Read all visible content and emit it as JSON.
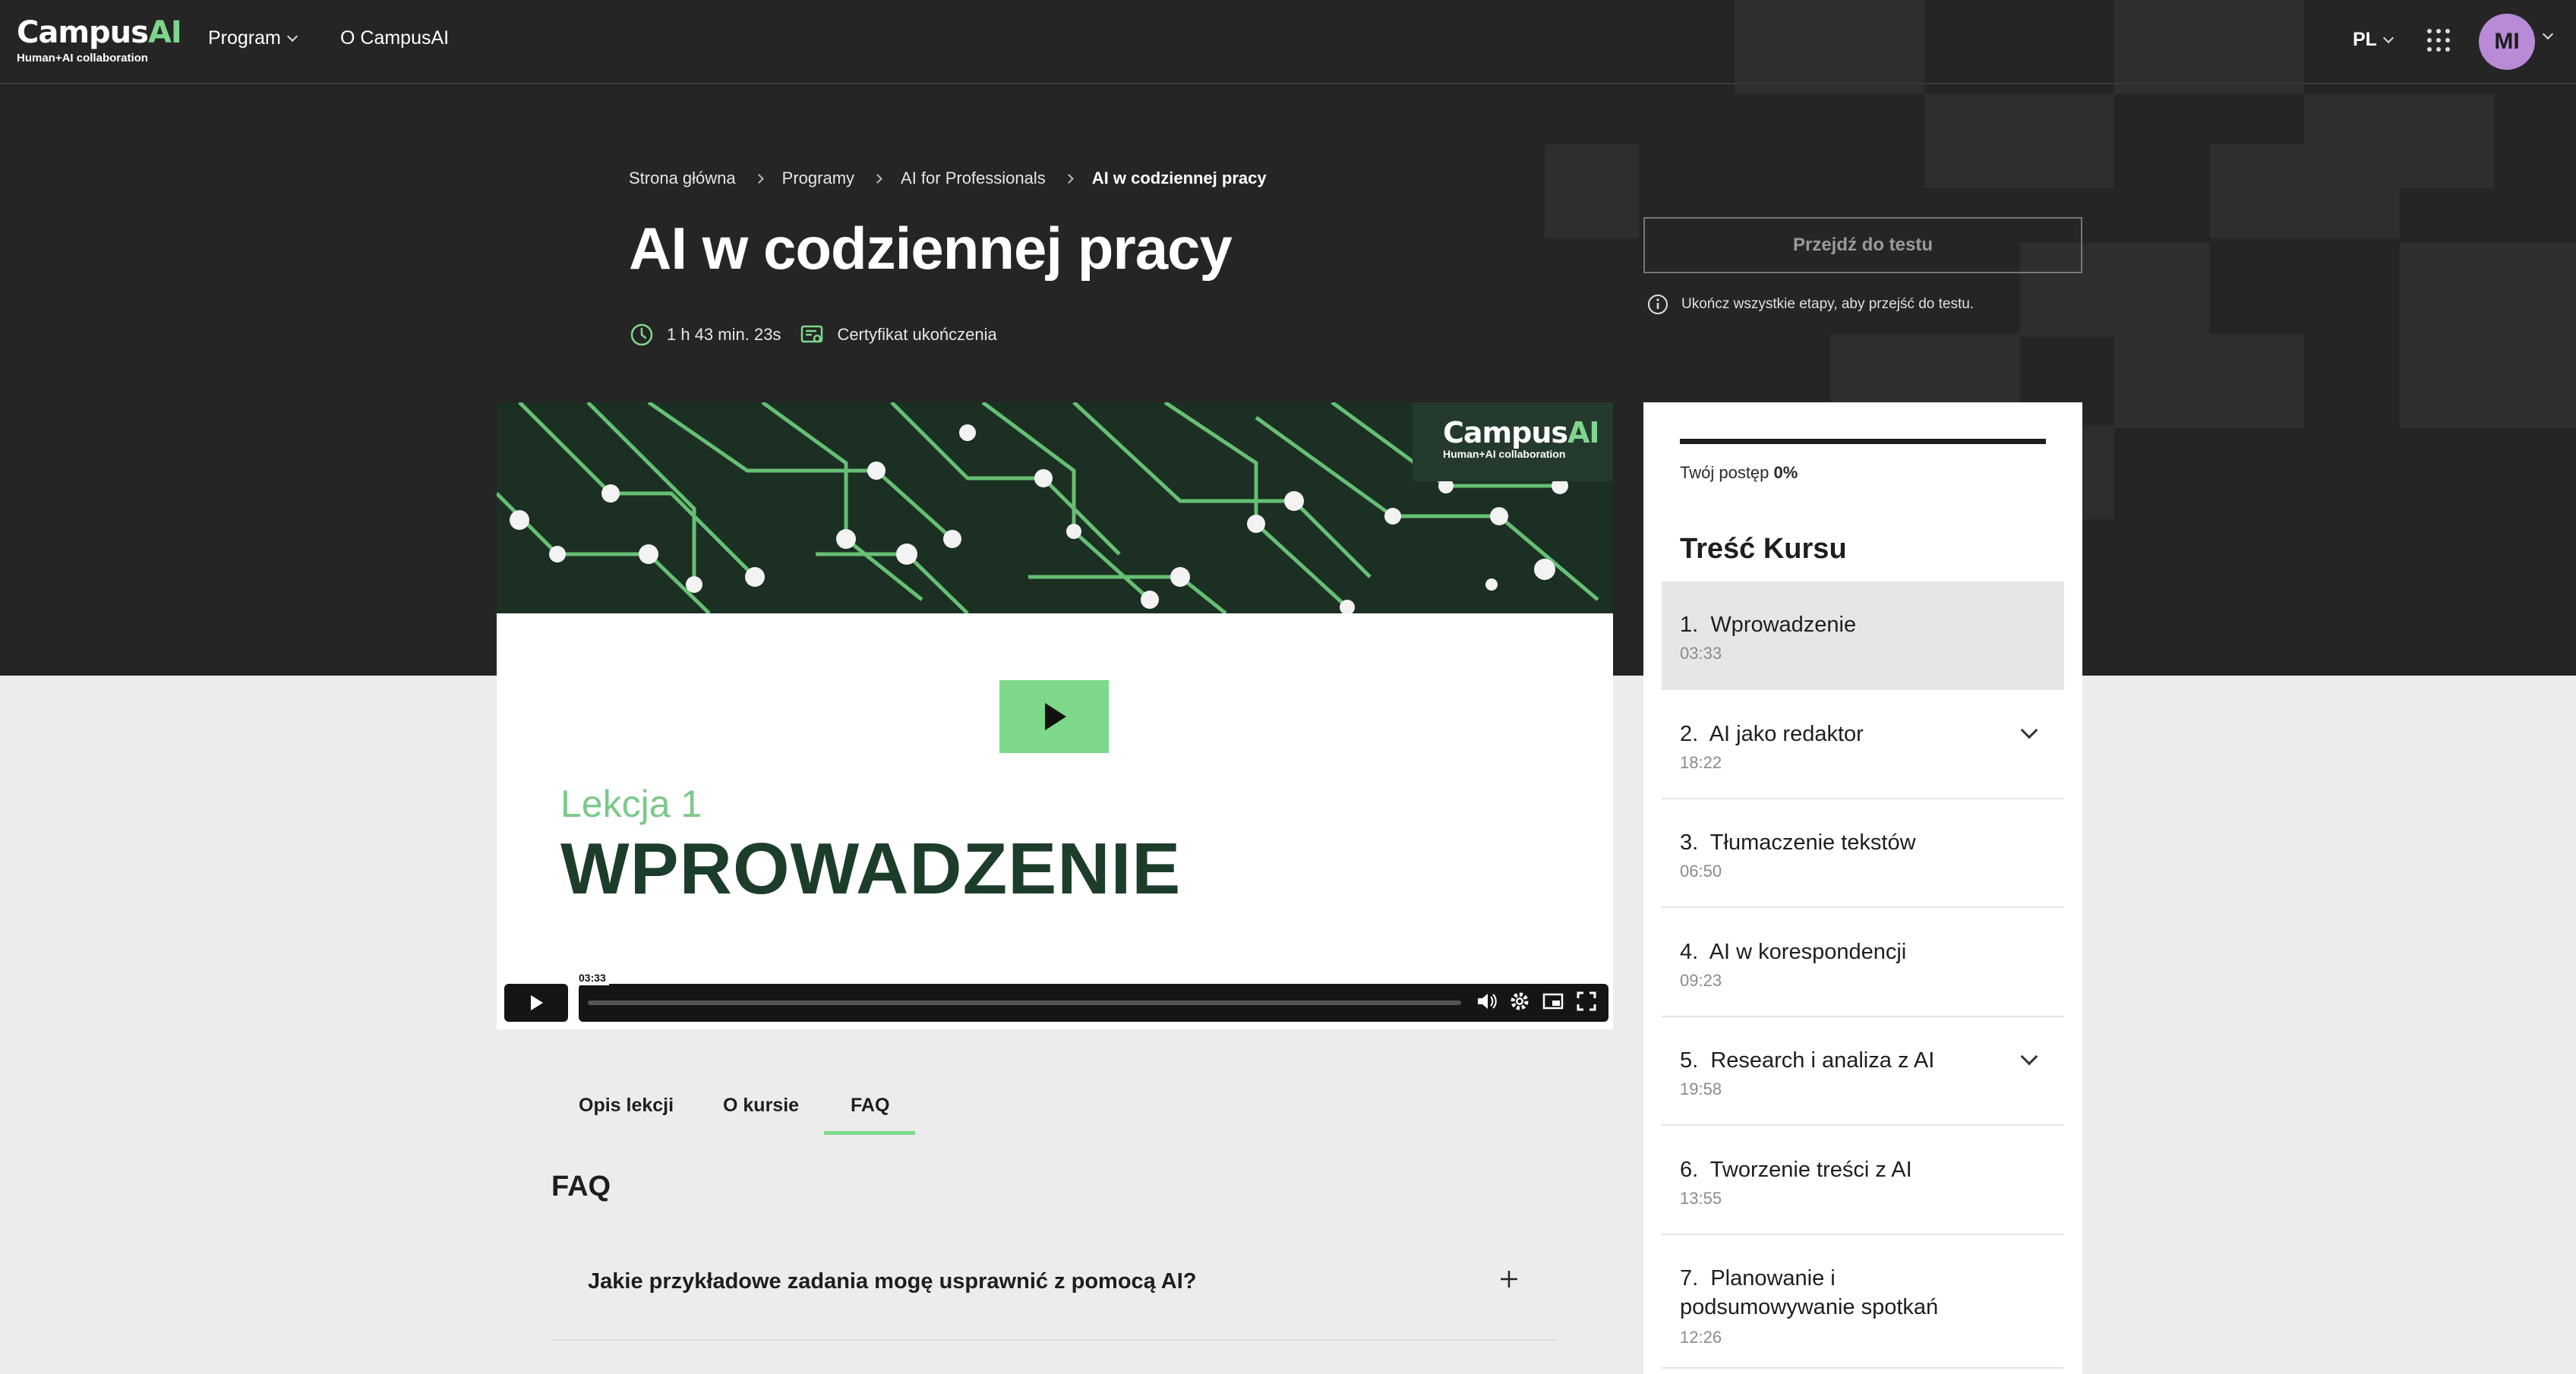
{
  "topbar": {
    "logo_word_main": "Campus",
    "logo_word_accent": "AI",
    "logo_sub": "Human+AI collaboration",
    "nav_program": "Program",
    "nav_about": "O CampusAI",
    "language": "PL",
    "avatar_initials": "MI"
  },
  "breadcrumbs": [
    "Strona główna",
    "Programy",
    "AI for Professionals",
    "AI w codziennej pracy"
  ],
  "course": {
    "title": "AI w codziennej pracy",
    "duration": "1 h 43 min. 23s",
    "certificate": "Certyfikat ukończenia"
  },
  "test": {
    "button_label": "Przejdź do testu",
    "note": "Ukończ wszystkie etapy, aby przejść do testu."
  },
  "video": {
    "banner_logo_main": "Campus",
    "banner_logo_accent": "AI",
    "banner_logo_sub": "Human+AI collaboration",
    "lesson_label": "Lekcja 1",
    "lesson_title": "WPROWADZENIE",
    "time_tooltip": "03:33",
    "progress": 0.0
  },
  "tabs": [
    "Opis lekcji",
    "O kursie",
    "FAQ"
  ],
  "active_tab": "FAQ",
  "faq": {
    "title": "FAQ",
    "questions": [
      "Jakie przykładowe zadania mogę usprawnić z pomocą AI?"
    ]
  },
  "sidebar": {
    "progress_label": "Twój postęp",
    "progress_value": "0%",
    "title": "Treść Kursu",
    "modules": [
      {
        "num": "1.",
        "title": "Wprowadzenie",
        "time": "03:33",
        "active": true,
        "expandable": false
      },
      {
        "num": "2.",
        "title": "AI jako redaktor",
        "time": "18:22",
        "active": false,
        "expandable": true
      },
      {
        "num": "3.",
        "title": "Tłumaczenie tekstów",
        "time": "06:50",
        "active": false,
        "expandable": false
      },
      {
        "num": "4.",
        "title": "AI w korespondencji",
        "time": "09:23",
        "active": false,
        "expandable": false
      },
      {
        "num": "5.",
        "title": "Research i analiza z AI",
        "time": "19:58",
        "active": false,
        "expandable": true
      },
      {
        "num": "6.",
        "title": "Tworzenie treści z AI",
        "time": "13:55",
        "active": false,
        "expandable": false
      },
      {
        "num": "7.",
        "title": "Planowanie i podsumowywanie spotkań",
        "time": "12:26",
        "active": false,
        "expandable": false
      }
    ]
  },
  "colors": {
    "hero_bg": "#252525",
    "accent_green": "#7dd88a",
    "avatar_bg": "#b98ad6",
    "lesson_title": "#1d3d2b"
  }
}
